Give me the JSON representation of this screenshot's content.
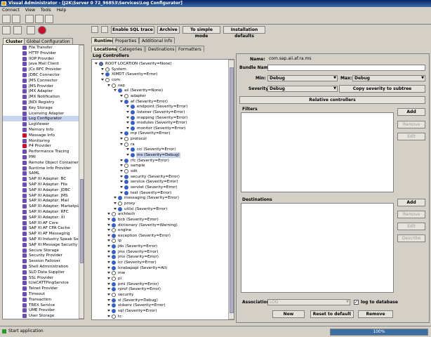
{
  "window": {
    "title": "Visual Administrator - [J2K\\Server 0 72_96853\\Services\\Log Configurator]"
  },
  "menu": [
    "Connect",
    "View",
    "Tools",
    "Help"
  ],
  "left": {
    "tabs": [
      "Cluster",
      "Global Configuration"
    ],
    "items": [
      "File Transfer",
      "HTTP Provider",
      "IIOP Provider",
      "Java Mail Client",
      "JCo RFC Provider",
      "JDBC Connector",
      "JMS Connector",
      "JMS Provider",
      "JMX Adapter",
      "JMX Notification",
      "JNDI Registry",
      "Key Storage",
      "Licensing Adapter",
      "Log Configurator",
      "LogViewer",
      "Memory Info",
      "Message Info",
      "Monitoring",
      "P4 Provider",
      "Performance Tracing",
      "PMI",
      "Remote Object Container",
      "Runtime Info Provider",
      "SAML",
      "SAP XI Adapter: BC",
      "SAP XI Adapter: File",
      "SAP XI Adapter: JDBC",
      "SAP XI Adapter: JMS",
      "SAP XI Adapter: Mail",
      "SAP XI Adapter: Marketpla",
      "SAP XI Adapter: RFC",
      "SAP XI Adapter: XI",
      "SAP XI AF Core",
      "SAP XI AF CPA Cache",
      "SAP XI AF Messaging",
      "SAP XI Industry Speak Ser",
      "SAP XI Message Security",
      "Secure Storage",
      "Security Provider",
      "Session Failover",
      "Shell Administration",
      "SLD Data Supplier",
      "SSL Provider",
      "tcleCATTPingService",
      "Telnet Provider",
      "Timeout",
      "Transaction",
      "TREX Service",
      "UME Provider",
      "User Storage"
    ]
  },
  "toolbar": {
    "sql_trace": "Enable SQL trace",
    "archive": "Archive",
    "simple_mode": "To simple mode",
    "install_defaults": "Installation defaults"
  },
  "main": {
    "tabs": [
      "Runtime",
      "Properties",
      "Additional Info"
    ],
    "subtabs": [
      "Locations",
      "Categories",
      "Destinations",
      "Formatters"
    ],
    "controllers_title": "Log Controllers",
    "tree": [
      {
        "d": 0,
        "t": "ROOT LOCATION (Severity=None)",
        "i": "node"
      },
      {
        "d": 1,
        "t": "System",
        "i": "open"
      },
      {
        "d": 1,
        "t": "XIMDT (Severity=Error)",
        "i": "blue"
      },
      {
        "d": 1,
        "t": "com",
        "i": "open"
      },
      {
        "d": 2,
        "t": "sap",
        "i": "open"
      },
      {
        "d": 3,
        "t": "aii (Severity=None)",
        "i": "blue"
      },
      {
        "d": 4,
        "t": "adapter",
        "i": "open"
      },
      {
        "d": 4,
        "t": "af (Severity=Error)",
        "i": "blue"
      },
      {
        "d": 5,
        "t": "endpoint (Severity=Error)",
        "i": "blue"
      },
      {
        "d": 5,
        "t": "listener (Severity=Error)",
        "i": "blue"
      },
      {
        "d": 5,
        "t": "mapping (Severity=Error)",
        "i": "blue"
      },
      {
        "d": 5,
        "t": "modules (Severity=Error)",
        "i": "blue"
      },
      {
        "d": 5,
        "t": "monitor (Severity=Error)",
        "i": "blue"
      },
      {
        "d": 4,
        "t": "mp (Severity=Error)",
        "i": "blue"
      },
      {
        "d": 4,
        "t": "protocol",
        "i": "open"
      },
      {
        "d": 4,
        "t": "ra",
        "i": "open"
      },
      {
        "d": 5,
        "t": "cci (Severity=Error)",
        "i": "blue"
      },
      {
        "d": 5,
        "t": "ms (Severity=Debug)",
        "i": "blue",
        "sel": true
      },
      {
        "d": 4,
        "t": "rfc (Severity=Error)",
        "i": "blue"
      },
      {
        "d": 4,
        "t": "sample",
        "i": "open"
      },
      {
        "d": 4,
        "t": "sdk",
        "i": "open"
      },
      {
        "d": 4,
        "t": "security (Severity=Error)",
        "i": "blue"
      },
      {
        "d": 4,
        "t": "service (Severity=Error)",
        "i": "blue"
      },
      {
        "d": 4,
        "t": "servlet (Severity=Error)",
        "i": "blue"
      },
      {
        "d": 4,
        "t": "test (Severity=Error)",
        "i": "blue"
      },
      {
        "d": 3,
        "t": "messaging (Severity=Error)",
        "i": "blue"
      },
      {
        "d": 3,
        "t": "proxy",
        "i": "open"
      },
      {
        "d": 3,
        "t": "utilxi (Severity=Error)",
        "i": "blue"
      },
      {
        "d": 2,
        "t": "archtech",
        "i": "open"
      },
      {
        "d": 2,
        "t": "bcb (Severity=Error)",
        "i": "blue"
      },
      {
        "d": 2,
        "t": "dictionary (Severity=Warning)",
        "i": "blue"
      },
      {
        "d": 2,
        "t": "engine",
        "i": "open"
      },
      {
        "d": 2,
        "t": "exception (Severity=Error)",
        "i": "blue"
      },
      {
        "d": 2,
        "t": "ip",
        "i": "open"
      },
      {
        "d": 2,
        "t": "jdo (Severity=Error)",
        "i": "blue"
      },
      {
        "d": 2,
        "t": "jms (Severity=Error)",
        "i": "blue"
      },
      {
        "d": 2,
        "t": "jmx (Severity=Error)",
        "i": "blue"
      },
      {
        "d": 2,
        "t": "lcr (Severity=Error)",
        "i": "blue"
      },
      {
        "d": 2,
        "t": "lcrabapapi (Severity=All)",
        "i": "blue"
      },
      {
        "d": 2,
        "t": "mw",
        "i": "open"
      },
      {
        "d": 2,
        "t": "pl",
        "i": "open"
      },
      {
        "d": 2,
        "t": "pmi (Severity=Error)",
        "i": "blue"
      },
      {
        "d": 2,
        "t": "rprof (Severity=Error)",
        "i": "blue"
      },
      {
        "d": 2,
        "t": "security",
        "i": "open"
      },
      {
        "d": 2,
        "t": "sl (Severity=Debug)",
        "i": "blue"
      },
      {
        "d": 2,
        "t": "sldserv (Severity=Error)",
        "i": "blue"
      },
      {
        "d": 2,
        "t": "sql (Severity=Error)",
        "i": "blue"
      },
      {
        "d": 2,
        "t": "tc",
        "i": "open"
      }
    ]
  },
  "details": {
    "name_label": "Name:",
    "name_value": "com.sap.aii.af.ra.ms",
    "bundle_label": "Bundle Name:",
    "bundle_value": "",
    "min_label": "Min:",
    "min_value": "Debug",
    "max_label": "Max:",
    "max_value": "Debug",
    "severity_label": "Severity:",
    "severity_value": "Debug",
    "copy_btn": "Copy severity to subtree",
    "relative_btn": "Relative controllers",
    "filters_label": "Filters",
    "filter_buttons": [
      "Add",
      "Remove",
      "Edit"
    ],
    "destinations_label": "Destinations",
    "dest_buttons": [
      "Add",
      "Remove",
      "Edit",
      "Describe"
    ],
    "association_label": "Association",
    "association_value": "LOG",
    "log_to_db": "log to database",
    "bottom_buttons": [
      "New",
      "Reset to default",
      "Remove"
    ]
  },
  "status": {
    "text": "Start application",
    "progress_label": "100%",
    "progress": 1.0
  }
}
